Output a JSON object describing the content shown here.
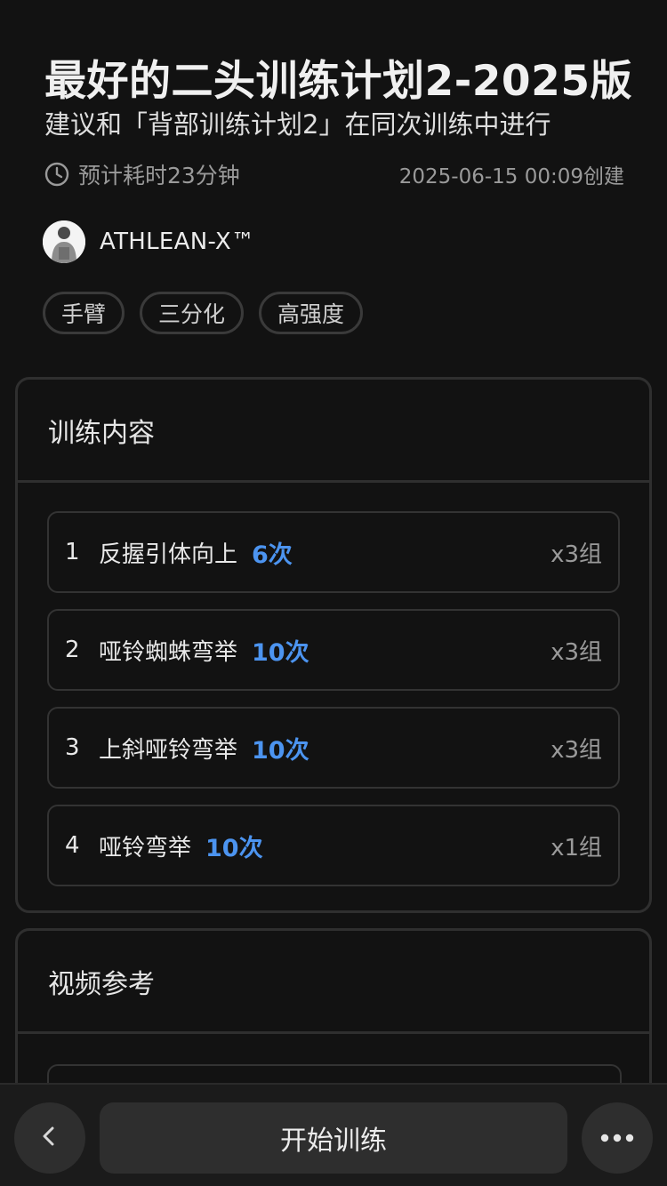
{
  "plan": {
    "title": "最好的二头训练计划2-2025版",
    "subtitle": "建议和「背部训练计划2」在同次训练中进行",
    "duration": "预计耗时23分钟",
    "created": "2025-06-15 00:09创建"
  },
  "author": {
    "name": "ATHLEAN-X™"
  },
  "tags": [
    "手臂",
    "三分化",
    "高强度"
  ],
  "training": {
    "heading": "训练内容",
    "exercises": [
      {
        "num": "1",
        "name": "反握引体向上",
        "reps": "6次",
        "sets": "x3组"
      },
      {
        "num": "2",
        "name": "哑铃蜘蛛弯举",
        "reps": "10次",
        "sets": "x3组"
      },
      {
        "num": "3",
        "name": "上斜哑铃弯举",
        "reps": "10次",
        "sets": "x3组"
      },
      {
        "num": "4",
        "name": "哑铃弯举",
        "reps": "10次",
        "sets": "x1组"
      }
    ]
  },
  "video": {
    "heading": "视频参考"
  },
  "bottom": {
    "start_label": "开始训练"
  },
  "icons": {
    "duration": "clock-icon",
    "back": "chevron-left-icon",
    "more": "more-icon"
  },
  "colors": {
    "accent": "#4c94f0",
    "background": "#121212"
  }
}
